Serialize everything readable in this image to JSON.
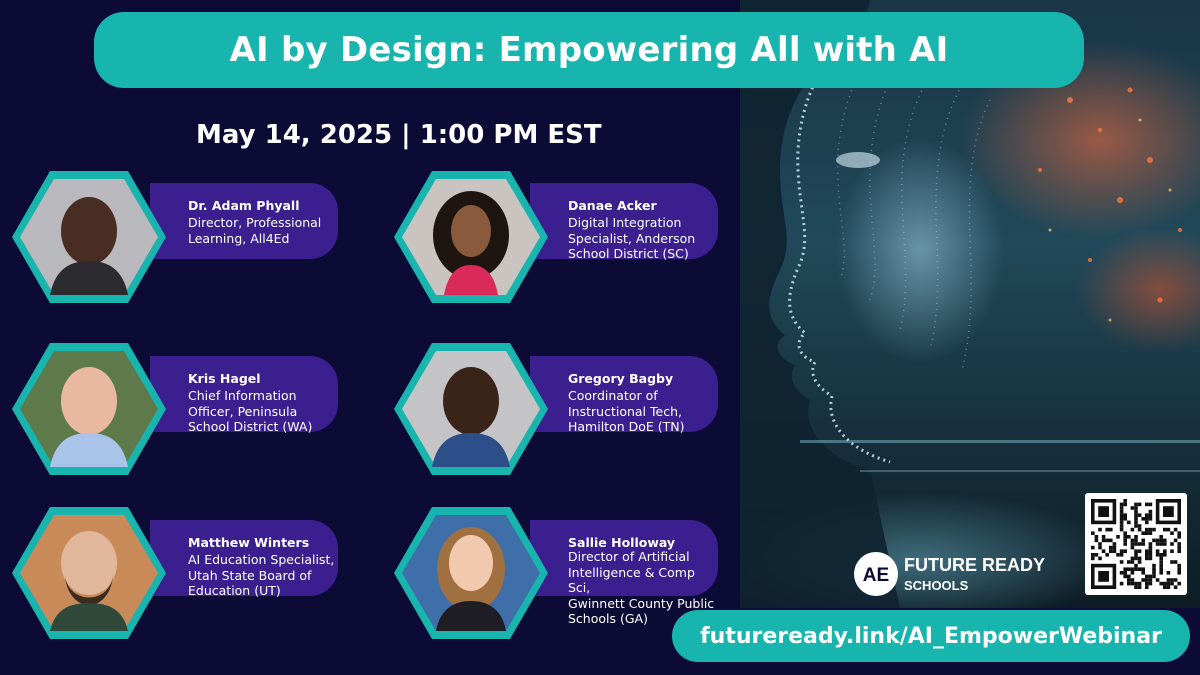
{
  "title": "AI by Design: Empowering All with AI",
  "date_time": "May 14, 2025 | 1:00 PM EST",
  "speakers": [
    {
      "name": "Dr. Adam Phyall",
      "role": [
        "Director, Professional",
        "Learning, All4Ed"
      ]
    },
    {
      "name": "Danae Acker",
      "role": [
        "Digital Integration",
        "Specialist, Anderson",
        "School District (SC)"
      ]
    },
    {
      "name": "Kris Hagel",
      "role": [
        "Chief Information",
        "Officer, Peninsula",
        "School District (WA)"
      ]
    },
    {
      "name": "Gregory Bagby",
      "role": [
        "Coordinator of",
        "Instructional Tech,",
        "Hamilton DoE (TN)"
      ]
    },
    {
      "name": "Matthew Winters",
      "role": [
        "AI Education Specialist,",
        "Utah State Board of",
        "Education (UT)"
      ]
    },
    {
      "name": "Sallie Holloway",
      "role": [
        "Director of Artificial",
        "Intelligence & Comp Sci,",
        "Gwinnett County Public",
        "Schools (GA)"
      ]
    }
  ],
  "logo": {
    "mark": "AE",
    "line1": "FUTURE READY",
    "line2": "SCHOOLS"
  },
  "url": "futureready.link/AI_EmpowerWebinar",
  "colors": {
    "background": "#0b0b36",
    "teal": "#17b5ae",
    "purple": "#3c1f8e"
  },
  "icons": [
    "future-ready-schools-logo",
    "qr-code"
  ]
}
